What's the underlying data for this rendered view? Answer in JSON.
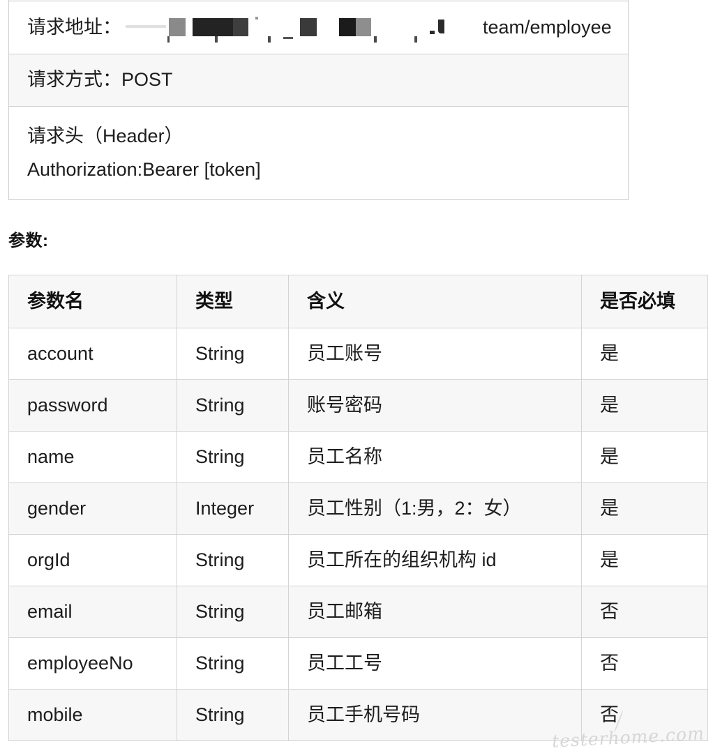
{
  "request_info": {
    "partial_row_above": "",
    "rows": [
      {
        "label": "请求地址：",
        "redacted": true,
        "visible_tail": "team/employee"
      },
      {
        "label": "请求方式：POST"
      },
      {
        "line1": "请求头（Header）",
        "line2": "Authorization:Bearer [token]"
      }
    ]
  },
  "params_section": {
    "label": "参数:",
    "columns": [
      "参数名",
      "类型",
      "含义",
      "是否必填"
    ],
    "rows": [
      {
        "name": "account",
        "type": "String",
        "desc": "员工账号",
        "required": "是"
      },
      {
        "name": "password",
        "type": "String",
        "desc": "账号密码",
        "required": "是"
      },
      {
        "name": "name",
        "type": "String",
        "desc": "员工名称",
        "required": "是"
      },
      {
        "name": "gender",
        "type": "Integer",
        "desc": "员工性别（1:男，2：女）",
        "required": "是"
      },
      {
        "name": "orgId",
        "type": "String",
        "desc": "员工所在的组织机构 id",
        "required": "是"
      },
      {
        "name": "email",
        "type": "String",
        "desc": "员工邮箱",
        "required": "否"
      },
      {
        "name": "employeeNo",
        "type": "String",
        "desc": "员工工号",
        "required": "否"
      },
      {
        "name": "mobile",
        "type": "String",
        "desc": "员工手机号码",
        "required": "否"
      }
    ]
  },
  "watermark": {
    "text": "testerhome.com"
  },
  "colors": {
    "border": "#d4d4d4",
    "stripe": "#f7f7f7",
    "text": "#1d1d1d",
    "watermark": "#d6d6d6"
  }
}
